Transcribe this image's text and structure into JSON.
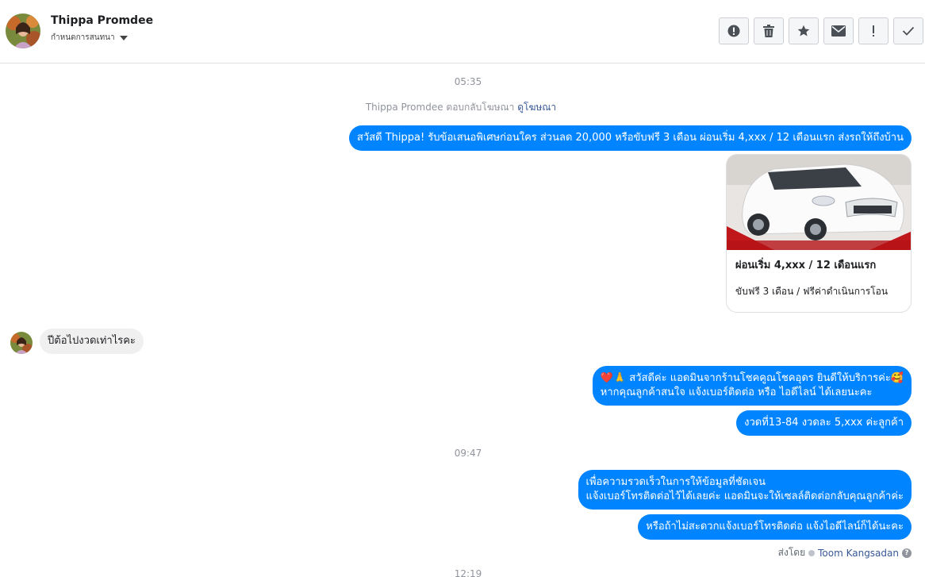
{
  "header": {
    "contact_name": "Thippa Promdee",
    "status_label": "กำหนดการสนทนา"
  },
  "toolbar": {
    "buttons": [
      "spam-icon",
      "trash-icon",
      "star-icon",
      "envelope-icon",
      "exclamation-icon",
      "check-icon"
    ]
  },
  "chat": {
    "time_1": "05:35",
    "reply_note_prefix": "Thippa Promdee ตอบกลับโฆษณา",
    "reply_note_link": "ดูโฆษณา",
    "msg_offer": "สวัสดี Thippa! รับข้อเสนอพิเศษก่อนใคร ส่วนลด 20,000 หรือขับฟรี 3 เดือน ผ่อนเริ่ม 4,xxx / 12 เดือนแรก ส่งรถให้ถึงบ้าน",
    "card": {
      "title": "ผ่อนเริ่ม 4,xxx / 12 เดือนแรก",
      "subtitle": "ขับฟรี 3 เดือน / ฟรีค่าดำเนินการโอน"
    },
    "msg_in_1": "ปีต้อไปงวดเท่าไรคะ",
    "msg_out_2_line1": "❤️🙏 สวัสดีค่ะ แอดมินจากร้านโชคคูณโชคอุดร ยินดีให้บริการค่ะ🥰",
    "msg_out_2_line2": "หากคุณลูกค้าสนใจ แจ้งเบอร์ติดต่อ หรือ ไอดีไลน์ ได้เลยนะคะ",
    "msg_out_3": "งวดที่13-84 งวดละ 5,xxx ค่ะลูกค้า",
    "time_2": "09:47",
    "msg_out_4_line1": "เพื่อความรวดเร็วในการให้ข้อมูลที่ชัดเจน",
    "msg_out_4_line2": "แจ้งเบอร์โทรติดต่อไว้ได้เลยค่ะ แอดมินจะให้เซลล์ติดต่อกลับคุณลูกค้าค่ะ",
    "msg_out_5": "หรือถ้าไม่สะดวกแจ้งเบอร์โทรติดต่อ แจ้งไอดีไลน์ก็ได้นะคะ",
    "sent_by_label": "ส่งโดย",
    "sent_by_name": "Toom Kangsadan",
    "time_3": "12:19"
  },
  "colors": {
    "accent": "#0084ff",
    "link": "#385898",
    "muted": "#90949c"
  }
}
